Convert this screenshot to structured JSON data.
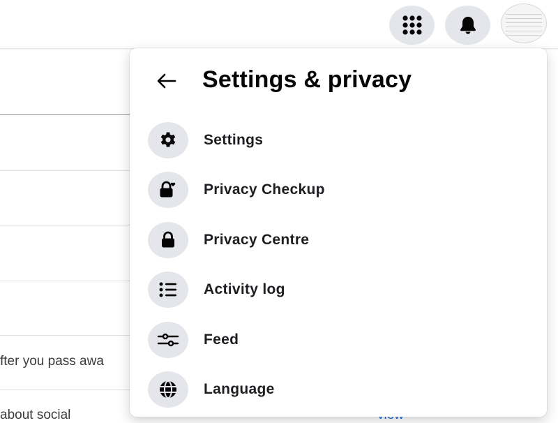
{
  "topbar": {
    "icons": [
      "menu-grid-icon",
      "notifications-bell-icon",
      "profile-avatar"
    ]
  },
  "background": {
    "text_line_1": "fter you pass awa",
    "text_line_2": "about social",
    "link_text": "view"
  },
  "panel": {
    "back_icon": "arrow-left-icon",
    "title": "Settings & privacy",
    "items": [
      {
        "label": "Settings",
        "icon": "gear-icon"
      },
      {
        "label": "Privacy Checkup",
        "icon": "lock-heart-icon"
      },
      {
        "label": "Privacy Centre",
        "icon": "lock-icon"
      },
      {
        "label": "Activity log",
        "icon": "list-icon"
      },
      {
        "label": "Feed",
        "icon": "sliders-icon"
      },
      {
        "label": "Language",
        "icon": "globe-icon"
      }
    ]
  },
  "colors": {
    "icon_bg": "#e4e6eb",
    "text": "#1c1e21",
    "link": "#216fdb"
  }
}
